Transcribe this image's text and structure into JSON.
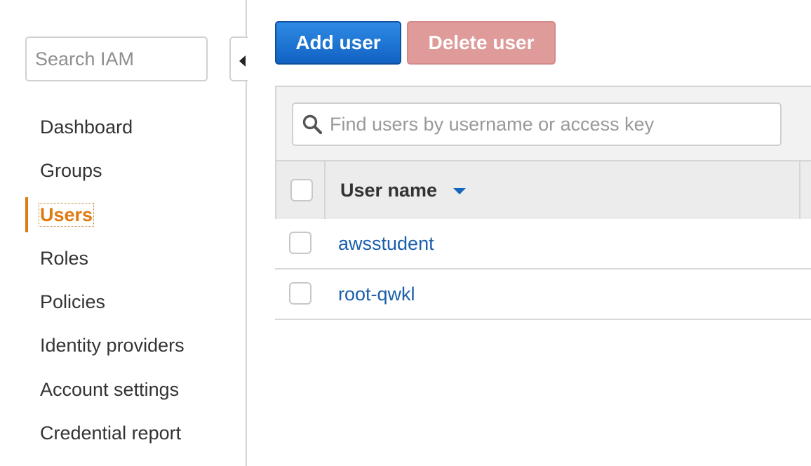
{
  "sidebar": {
    "search_placeholder": "Search IAM",
    "items": [
      {
        "label": "Dashboard",
        "active": false
      },
      {
        "label": "Groups",
        "active": false
      },
      {
        "label": "Users",
        "active": true
      },
      {
        "label": "Roles",
        "active": false
      },
      {
        "label": "Policies",
        "active": false
      },
      {
        "label": "Identity providers",
        "active": false
      },
      {
        "label": "Account settings",
        "active": false
      },
      {
        "label": "Credential report",
        "active": false
      }
    ],
    "collapse_icon": "caret-left-icon"
  },
  "toolbar": {
    "add_user_label": "Add user",
    "delete_user_label": "Delete user"
  },
  "users_table": {
    "filter_placeholder": "Find users by username or access key",
    "filter_icon": "search-icon",
    "columns": [
      {
        "label": "User name",
        "sorted": "descending"
      }
    ],
    "rows": [
      {
        "user_name": "awsstudent"
      },
      {
        "user_name": "root-qwkl"
      }
    ]
  },
  "colors": {
    "active_nav": "#e07b11",
    "primary_button": "#1e75d6",
    "delete_button_disabled": "#df9a9a",
    "link": "#1b5fad"
  }
}
